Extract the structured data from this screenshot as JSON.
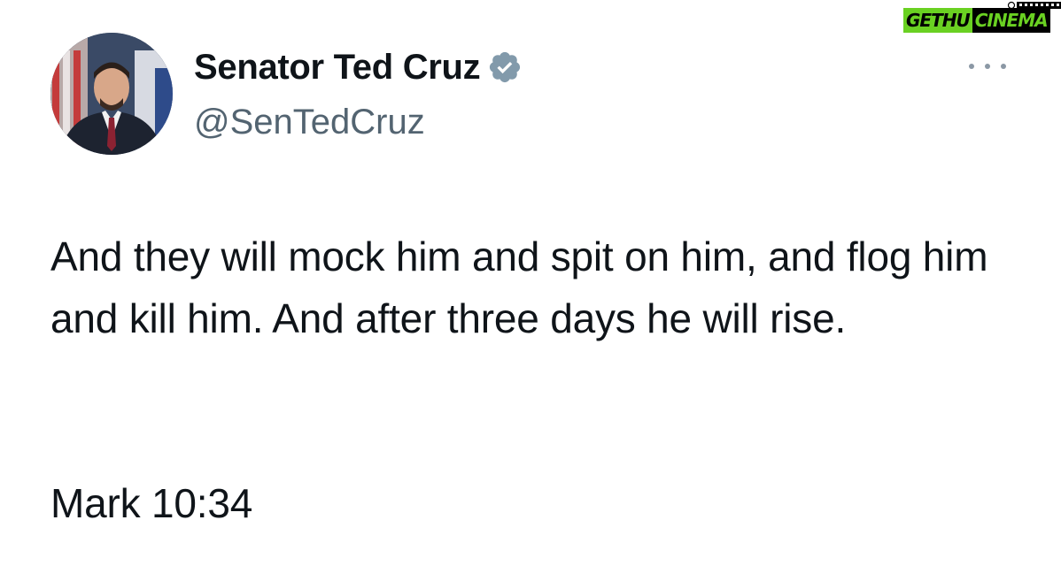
{
  "author": {
    "display_name": "Senator Ted Cruz",
    "handle": "@SenTedCruz",
    "verified_icon": "verified-badge-icon",
    "verified_color": "#829aab",
    "avatar_icon": "avatar"
  },
  "tweet": {
    "text": "And they will mock him and spit on him, and flog him and kill him. And after three days he will rise.",
    "reference": "Mark 10:34"
  },
  "menu": {
    "icon": "more-horizontal-icon"
  },
  "watermark": {
    "part1": "GETHU",
    "part2": "CINEMA",
    "accent": "#6ad122"
  }
}
